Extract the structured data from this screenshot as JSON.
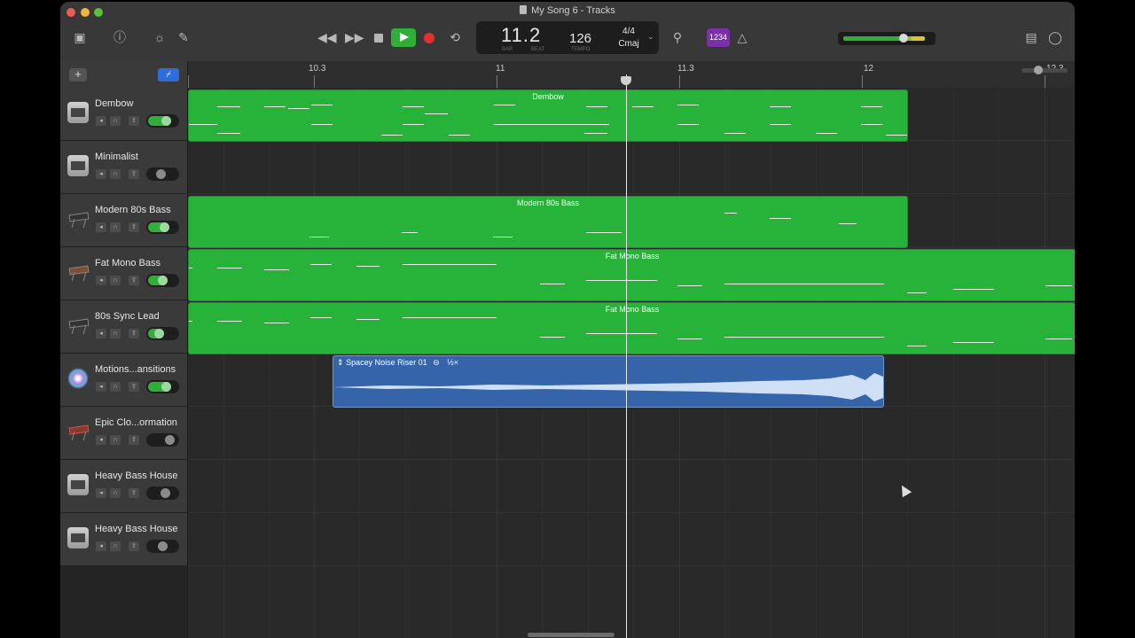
{
  "window": {
    "title": "My Song 6 - Tracks"
  },
  "toolbar": {
    "lcd": {
      "bar_beat": "11.2",
      "bar_label": "BAR",
      "beat_label": "BEAT",
      "tempo": "126",
      "tempo_label": "TEMPO",
      "time_signature": "4/4",
      "key": "Cmaj"
    },
    "count_in_label": "1234"
  },
  "ruler": {
    "labels": [
      "10.3",
      "11",
      "11.3",
      "12",
      "12.3"
    ]
  },
  "tracks": [
    {
      "name": "Dembow",
      "icon": "drum-machine-icon",
      "volume_on": true
    },
    {
      "name": "Minimalist",
      "icon": "drum-machine-icon",
      "volume_on": false
    },
    {
      "name": "Modern 80s Bass",
      "icon": "keyboard-icon",
      "volume_on": true
    },
    {
      "name": "Fat Mono Bass",
      "icon": "keyboard-icon",
      "volume_on": true
    },
    {
      "name": "80s Sync Lead",
      "icon": "keyboard-icon",
      "volume_on": true
    },
    {
      "name": "Motions...ansitions",
      "icon": "sparkle-icon",
      "volume_on": true
    },
    {
      "name": "Epic Clo...ormation",
      "icon": "keyboard-icon",
      "volume_on": false
    },
    {
      "name": "Heavy Bass House",
      "icon": "drum-machine-icon",
      "volume_on": false
    },
    {
      "name": "Heavy Bass House",
      "icon": "drum-machine-icon",
      "volume_on": false
    }
  ],
  "regions": [
    {
      "title": "Dembow",
      "track": 0,
      "type": "midi"
    },
    {
      "title": "Modern 80s Bass",
      "track": 2,
      "type": "midi"
    },
    {
      "title": "Fat Mono Bass",
      "track": 3,
      "type": "midi"
    },
    {
      "title": "Fat Mono Bass",
      "track": 4,
      "type": "midi"
    },
    {
      "title": "Spacey Noise Riser 01",
      "track": 5,
      "type": "audio",
      "badge": "½×"
    }
  ],
  "colors": {
    "midi_region": "#27b33a",
    "audio_region": "#3565a8",
    "play": "#2fae3a",
    "record": "#e23030",
    "count_in": "#7b2fa8"
  }
}
